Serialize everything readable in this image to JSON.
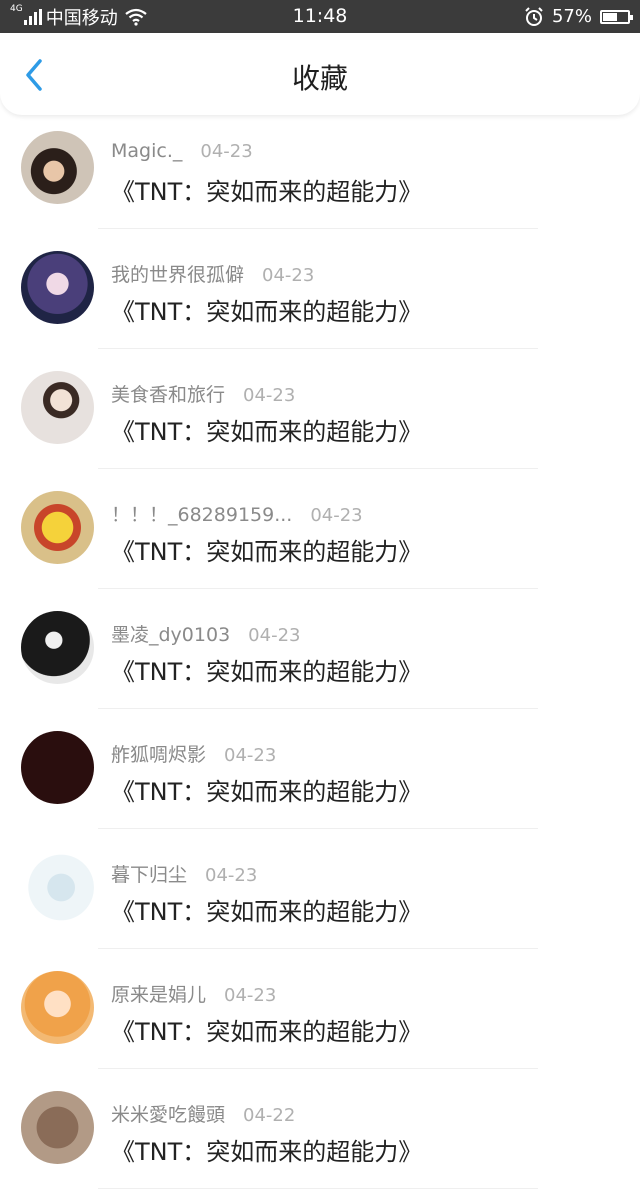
{
  "status_bar": {
    "network": "4G",
    "carrier": "中国移动",
    "time": "11:48",
    "battery": "57%",
    "battery_level": 0.57,
    "icons": [
      "signal-icon",
      "wifi-icon",
      "alarm-icon",
      "battery-icon"
    ]
  },
  "header": {
    "title": "收藏",
    "back_icon": "chevron-left-icon",
    "accent": "#2e9be6"
  },
  "items": [
    {
      "name": "Magic._",
      "date": "04-23",
      "title": "《TNT：突如而来的超能力》"
    },
    {
      "name": "我的世界很孤僻",
      "date": "04-23",
      "title": "《TNT：突如而来的超能力》"
    },
    {
      "name": "美食香和旅行",
      "date": "04-23",
      "title": "《TNT：突如而来的超能力》"
    },
    {
      "name": "！！！_68289159...",
      "date": "04-23",
      "title": "《TNT：突如而来的超能力》"
    },
    {
      "name": "墨凌_dy0103",
      "date": "04-23",
      "title": "《TNT：突如而来的超能力》"
    },
    {
      "name": "舴狐啁烬影",
      "date": "04-23",
      "title": "《TNT：突如而来的超能力》"
    },
    {
      "name": "暮下归尘",
      "date": "04-23",
      "title": "《TNT：突如而来的超能力》"
    },
    {
      "name": "原来是娟儿",
      "date": "04-23",
      "title": "《TNT：突如而来的超能力》"
    },
    {
      "name": "米米愛吃饅頭",
      "date": "04-22",
      "title": "《TNT：突如而来的超能力》"
    }
  ]
}
